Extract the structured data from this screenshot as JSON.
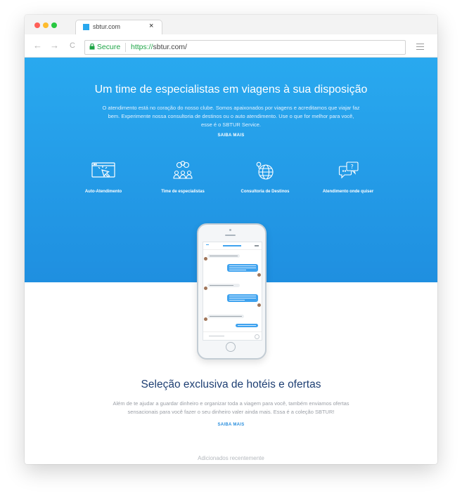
{
  "browser": {
    "tab_title": "sbtur.com",
    "tab_close": "×",
    "back_glyph": "←",
    "forward_glyph": "→",
    "reload_glyph": "C",
    "secure_label": "Secure",
    "url_scheme": "https://",
    "url_host": "sbtur.com/",
    "traffic_colors": [
      "#ff5f57",
      "#febc2e",
      "#28c840"
    ]
  },
  "hero": {
    "title": "Um time de especialistas em viagens à sua disposição",
    "text": "O atendimento está no coração do nosso clube. Somos apaixonados por viagens e acreditamos que viajar faz bem. Experimente nossa consultoria de destinos ou o auto atendimento. Use o que for melhor para você, esse é o SBTUR Service.",
    "cta": "SAIBA MAIS",
    "background": "#29a9ef"
  },
  "features": [
    {
      "label": "Auto-Atendimento",
      "icon": "self-service-icon"
    },
    {
      "label": "Time de especialistas",
      "icon": "team-icon"
    },
    {
      "label": "Consultoria de Destinos",
      "icon": "globe-icon"
    },
    {
      "label": "Atendimento onde quiser",
      "icon": "chat-bubbles-icon"
    }
  ],
  "selection": {
    "title": "Seleção exclusiva de hotéis e ofertas",
    "text": "Além de te ajudar a guardar dinheiro e organizar toda a viagem para você, também enviamos ofertas sensacionais para você fazer o seu dinheiro valer ainda mais. Essa é a coleção SBTUR!",
    "cta": "SAIBA MAIS"
  },
  "recent_label": "Adicionados recentemente"
}
